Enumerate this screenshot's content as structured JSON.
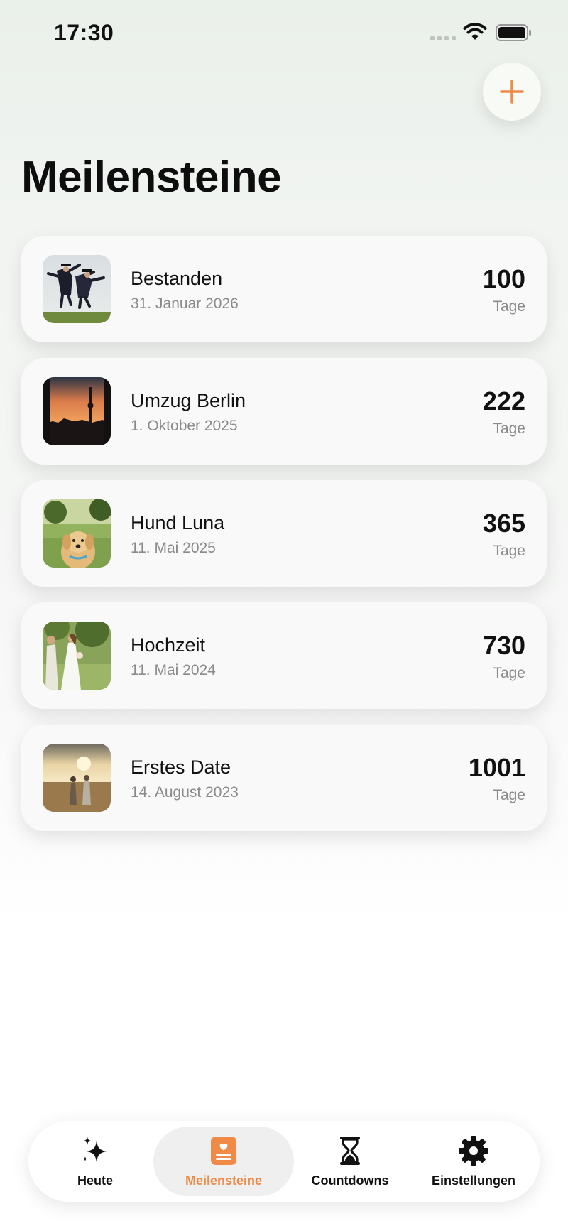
{
  "status_bar": {
    "time": "17:30"
  },
  "header": {
    "title": "Meilensteine"
  },
  "colors": {
    "accent": "#ef8a47",
    "card_bg": "#f8f9f8",
    "muted_text": "#8a8a8a"
  },
  "milestones": [
    {
      "title": "Bestanden",
      "date": "31. Januar 2026",
      "count": "100",
      "unit": "Tage",
      "thumbnail": "graduation-photo"
    },
    {
      "title": "Umzug Berlin",
      "date": "1. Oktober 2025",
      "count": "222",
      "unit": "Tage",
      "thumbnail": "berlin-sunset-photo"
    },
    {
      "title": "Hund Luna",
      "date": "11. Mai 2025",
      "count": "365",
      "unit": "Tage",
      "thumbnail": "dog-photo"
    },
    {
      "title": "Hochzeit",
      "date": "11. Mai 2024",
      "count": "730",
      "unit": "Tage",
      "thumbnail": "wedding-photo"
    },
    {
      "title": "Erstes Date",
      "date": "14. August 2023",
      "count": "1001",
      "unit": "Tage",
      "thumbnail": "first-date-photo"
    }
  ],
  "tabs": [
    {
      "label": "Heute",
      "icon": "sparkles-icon",
      "active": false
    },
    {
      "label": "Meilensteine",
      "icon": "milestone-card-icon",
      "active": true
    },
    {
      "label": "Countdowns",
      "icon": "hourglass-icon",
      "active": false
    },
    {
      "label": "Einstellungen",
      "icon": "gear-icon",
      "active": false
    }
  ]
}
